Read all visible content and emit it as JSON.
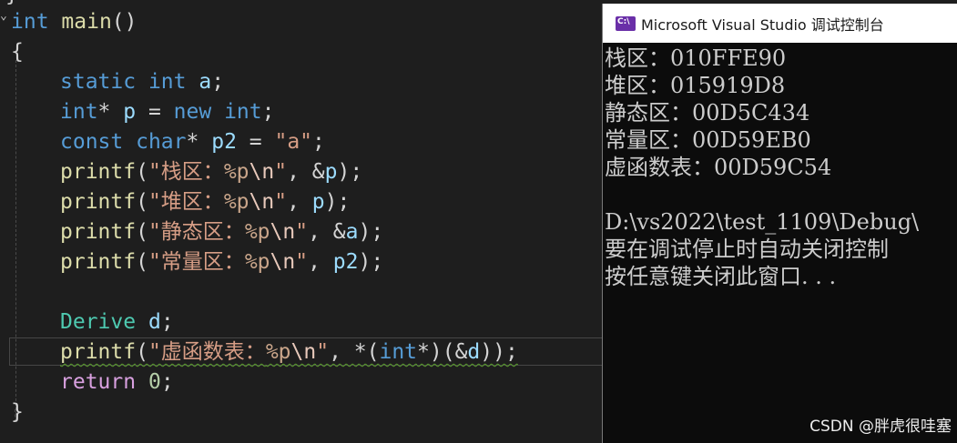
{
  "editor": {
    "top_fragment": "}",
    "fold_glyph": "⌄",
    "signature": {
      "type": "int",
      "name": "main",
      "parens": "()"
    },
    "open_brace": "{",
    "close_brace": "}",
    "line_static": {
      "kw1": "static",
      "kw2": "int",
      "var": "a",
      "end": ";"
    },
    "line_new": {
      "type": "int",
      "star": "*",
      "var": "p",
      "eq": " = ",
      "kw_new": "new",
      "type2": "int",
      "end": ";"
    },
    "line_const": {
      "kw1": "const",
      "kw2": "char",
      "star": "*",
      "var": "p2",
      "eq": " = ",
      "str": "\"a\"",
      "end": ";"
    },
    "printf_fn": "printf",
    "printf_lines": [
      {
        "label": "\"栈区：",
        "spec": "%p",
        "esc": "\\n",
        "close": "\"",
        "sep": ", ",
        "amp": "&",
        "arg": "p",
        "end": ");"
      },
      {
        "label": "\"堆区：",
        "spec": "%p",
        "esc": "\\n",
        "close": "\"",
        "sep": ", ",
        "amp": "",
        "arg": "p",
        "end": ");"
      },
      {
        "label": "\"静态区：",
        "spec": "%p",
        "esc": "\\n",
        "close": "\"",
        "sep": ", ",
        "amp": "&",
        "arg": "a",
        "end": ");"
      },
      {
        "label": "\"常量区：",
        "spec": "%p",
        "esc": "\\n",
        "close": "\"",
        "sep": ", ",
        "amp": "",
        "arg": "p2",
        "end": ");"
      }
    ],
    "line_derive": {
      "type": "Derive",
      "var": "d",
      "end": ";"
    },
    "line_vtable": {
      "label": "\"虚函数表：",
      "spec": "%p",
      "esc": "\\n",
      "close": "\"",
      "sep": ", ",
      "cast_open": "*(",
      "cast_type": "int",
      "cast_close": "*)(&",
      "arg": "d",
      "end": "));"
    },
    "line_return": {
      "kw": "return",
      "num": "0",
      "end": ";"
    }
  },
  "console": {
    "icon_label": "C:\\",
    "title": "Microsoft Visual Studio 调试控制台",
    "lines": [
      "栈区：010FFE90",
      "堆区：015919D8",
      "静态区：00D5C434",
      "常量区：00D59EB0",
      "虚函数表：00D59C54",
      "",
      "D:\\vs2022\\test_1109\\Debug\\",
      "要在调试停止时自动关闭控制",
      "按任意键关闭此窗口. . ."
    ]
  },
  "watermark": "CSDN @胖虎很哇塞"
}
